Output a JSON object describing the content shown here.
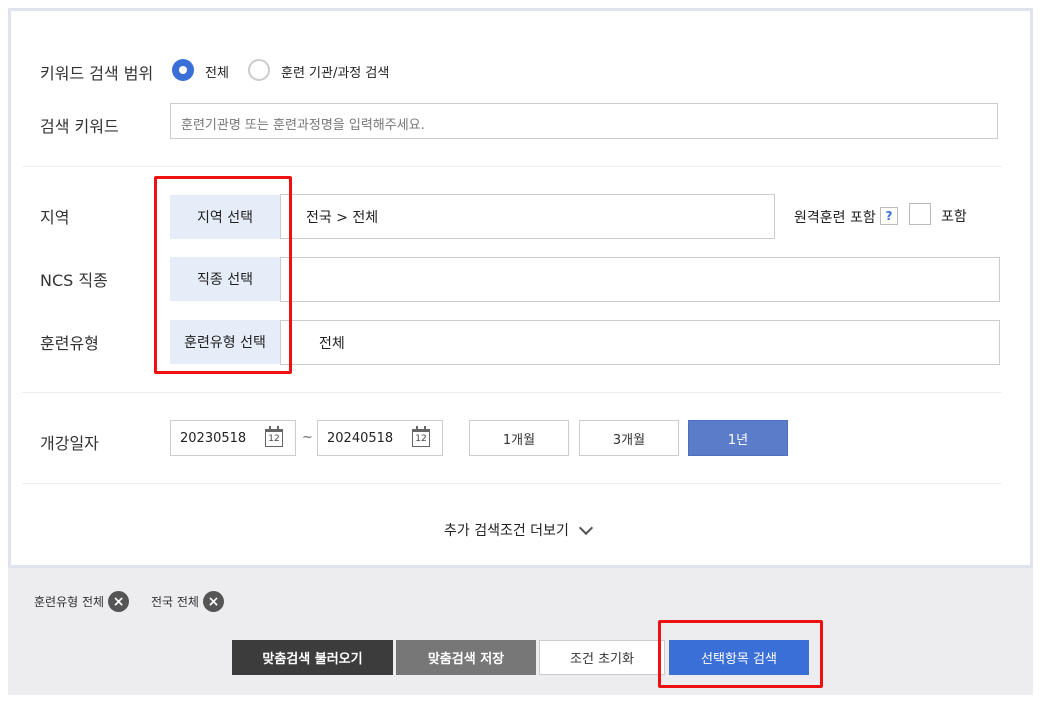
{
  "keyword_scope": {
    "label": "키워드 검색 범위",
    "option_all": "전체",
    "option_institution": "훈련 기관/과정 검색",
    "selected": "전체"
  },
  "keyword": {
    "label": "검색 키워드",
    "placeholder": "훈련기관명 또는 훈련과정명을 입력해주세요."
  },
  "region": {
    "label": "지역",
    "button": "지역 선택",
    "value": "전국 > 전체",
    "remote_label": "원격훈련 포함",
    "help": "?",
    "include_label": "포함"
  },
  "ncs": {
    "label": "NCS 직종",
    "button": "직종 선택",
    "value": ""
  },
  "training_type": {
    "label": "훈련유형",
    "button": "훈련유형 선택",
    "value": "전체"
  },
  "open_date": {
    "label": "개강일자",
    "start": "20230518",
    "end": "20240518",
    "separator": "~",
    "calendar_day": "12",
    "periods": [
      "1개월",
      "3개월",
      "1년"
    ],
    "active_period": "1년"
  },
  "more_conditions": "추가 검색조건 더보기",
  "chips": [
    {
      "label": "훈련유형 전체"
    },
    {
      "label": "전국 전체"
    }
  ],
  "actions": {
    "load": "맞춤검색 불러오기",
    "save": "맞춤검색 저장",
    "reset": "조건 초기화",
    "search": "선택항목 검색"
  },
  "colors": {
    "accent": "#3a6fd8",
    "highlight": "#ee1111",
    "select_button_bg": "#e6edf8",
    "active_period_bg": "#5a7cc9"
  }
}
